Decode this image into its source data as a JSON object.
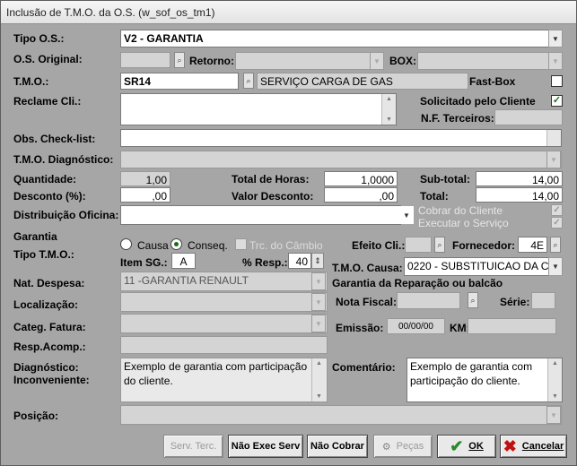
{
  "window": {
    "title": "Inclusão de T.M.O. da O.S. (w_sof_os_tm1)"
  },
  "labels": {
    "tipo_os": "Tipo O.S.:",
    "os_original": "O.S. Original:",
    "retorno": "Retorno:",
    "box": "BOX:",
    "tmo": "T.M.O.:",
    "fast_box": "Fast-Box",
    "reclame": "Reclame Cli.:",
    "solicitado": "Solicitado pelo Cliente",
    "nf_terceiros": "N.F. Terceiros:",
    "obs_checklist": "Obs. Check-list:",
    "tmo_diag": "T.M.O. Diagnóstico:",
    "quantidade": "Quantidade:",
    "total_horas": "Total de Horas:",
    "subtotal": "Sub-total:",
    "desconto": "Desconto (%):",
    "valor_desconto": "Valor Desconto:",
    "total": "Total:",
    "distribuicao": "Distribuição Oficina:",
    "cobrar_cliente": "Cobrar do Cliente",
    "executar_servico": "Executar o Serviço",
    "garantia": "Garantia",
    "tipo_tmo": "Tipo T.M.O.:",
    "causa": "Causa",
    "conseq": "Conseq.",
    "trc_cambio": "Trc. do Câmbio",
    "efeito_cli": "Efeito Cli.:",
    "fornecedor": "Fornecedor:",
    "item_sg": "Item SG.:",
    "pct_resp": "% Resp.:",
    "tmo_causa": "T.M.O. Causa:",
    "nat_despesa": "Nat. Despesa:",
    "garantia_reparacao": "Garantia da Reparação ou balcão",
    "localizacao": "Localização:",
    "nota_fiscal": "Nota Fiscal:",
    "serie": "Série:",
    "categ_fatura": "Categ. Fatura:",
    "emissao": "Emissão:",
    "km": "KM:",
    "resp_acomp": "Resp.Acomp.:",
    "diagnostico": "Diagnóstico:",
    "inconveniente": "Inconveniente:",
    "comentario": "Comentário:",
    "posicao": "Posição:"
  },
  "values": {
    "tipo_os": "V2 - GARANTIA",
    "tmo_code": "SR14",
    "tmo_desc": "SERVIÇO CARGA DE GAS",
    "quantidade": "1,00",
    "total_horas": "1,0000",
    "subtotal": "14,00",
    "desconto": ",00",
    "valor_desconto": ",00",
    "total": "14,00",
    "item_sg": "A",
    "pct_resp": "40",
    "fornecedor": "4E",
    "tmo_causa": "0220 - SUBSTITUICAO DA C",
    "nat_despesa": "11 -GARANTIA RENAULT",
    "emissao": "00/00/00",
    "diagnostico": "Exemplo de garantia com participação do cliente.",
    "comentario": "Exemplo de garantia com participação do cliente."
  },
  "buttons": {
    "serv_terc": "Serv. Terc.",
    "nao_exec_serv": "Não Exec Serv",
    "nao_cobrar": "Não Cobrar",
    "pecas": "Peças",
    "ok": "OK",
    "cancelar": "Cancelar"
  },
  "colors": {
    "check_green": "#1a6e1a",
    "cancel_red": "#c01010",
    "ok_green": "#2a8a2a"
  }
}
